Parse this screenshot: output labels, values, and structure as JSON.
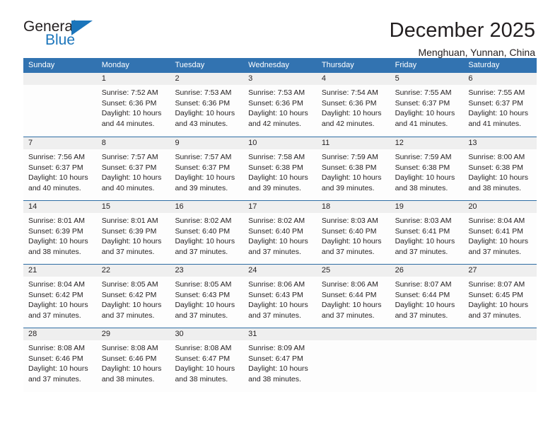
{
  "brand": {
    "name_top": "General",
    "name_bottom": "Blue",
    "accent_color": "#1b75bb"
  },
  "header": {
    "title": "December 2025",
    "subtitle": "Menghuan, Yunnan, China"
  },
  "calendar": {
    "header_bg": "#3273b1",
    "row_divider_color": "#2e6da4",
    "daynum_bg": "#efefef",
    "weekdays": [
      "Sunday",
      "Monday",
      "Tuesday",
      "Wednesday",
      "Thursday",
      "Friday",
      "Saturday"
    ],
    "weeks": [
      {
        "days": [
          {
            "num": "",
            "lines": []
          },
          {
            "num": "1",
            "lines": [
              "Sunrise: 7:52 AM",
              "Sunset: 6:36 PM",
              "Daylight: 10 hours",
              "and 44 minutes."
            ]
          },
          {
            "num": "2",
            "lines": [
              "Sunrise: 7:53 AM",
              "Sunset: 6:36 PM",
              "Daylight: 10 hours",
              "and 43 minutes."
            ]
          },
          {
            "num": "3",
            "lines": [
              "Sunrise: 7:53 AM",
              "Sunset: 6:36 PM",
              "Daylight: 10 hours",
              "and 42 minutes."
            ]
          },
          {
            "num": "4",
            "lines": [
              "Sunrise: 7:54 AM",
              "Sunset: 6:36 PM",
              "Daylight: 10 hours",
              "and 42 minutes."
            ]
          },
          {
            "num": "5",
            "lines": [
              "Sunrise: 7:55 AM",
              "Sunset: 6:37 PM",
              "Daylight: 10 hours",
              "and 41 minutes."
            ]
          },
          {
            "num": "6",
            "lines": [
              "Sunrise: 7:55 AM",
              "Sunset: 6:37 PM",
              "Daylight: 10 hours",
              "and 41 minutes."
            ]
          }
        ]
      },
      {
        "days": [
          {
            "num": "7",
            "lines": [
              "Sunrise: 7:56 AM",
              "Sunset: 6:37 PM",
              "Daylight: 10 hours",
              "and 40 minutes."
            ]
          },
          {
            "num": "8",
            "lines": [
              "Sunrise: 7:57 AM",
              "Sunset: 6:37 PM",
              "Daylight: 10 hours",
              "and 40 minutes."
            ]
          },
          {
            "num": "9",
            "lines": [
              "Sunrise: 7:57 AM",
              "Sunset: 6:37 PM",
              "Daylight: 10 hours",
              "and 39 minutes."
            ]
          },
          {
            "num": "10",
            "lines": [
              "Sunrise: 7:58 AM",
              "Sunset: 6:38 PM",
              "Daylight: 10 hours",
              "and 39 minutes."
            ]
          },
          {
            "num": "11",
            "lines": [
              "Sunrise: 7:59 AM",
              "Sunset: 6:38 PM",
              "Daylight: 10 hours",
              "and 39 minutes."
            ]
          },
          {
            "num": "12",
            "lines": [
              "Sunrise: 7:59 AM",
              "Sunset: 6:38 PM",
              "Daylight: 10 hours",
              "and 38 minutes."
            ]
          },
          {
            "num": "13",
            "lines": [
              "Sunrise: 8:00 AM",
              "Sunset: 6:38 PM",
              "Daylight: 10 hours",
              "and 38 minutes."
            ]
          }
        ]
      },
      {
        "days": [
          {
            "num": "14",
            "lines": [
              "Sunrise: 8:01 AM",
              "Sunset: 6:39 PM",
              "Daylight: 10 hours",
              "and 38 minutes."
            ]
          },
          {
            "num": "15",
            "lines": [
              "Sunrise: 8:01 AM",
              "Sunset: 6:39 PM",
              "Daylight: 10 hours",
              "and 37 minutes."
            ]
          },
          {
            "num": "16",
            "lines": [
              "Sunrise: 8:02 AM",
              "Sunset: 6:40 PM",
              "Daylight: 10 hours",
              "and 37 minutes."
            ]
          },
          {
            "num": "17",
            "lines": [
              "Sunrise: 8:02 AM",
              "Sunset: 6:40 PM",
              "Daylight: 10 hours",
              "and 37 minutes."
            ]
          },
          {
            "num": "18",
            "lines": [
              "Sunrise: 8:03 AM",
              "Sunset: 6:40 PM",
              "Daylight: 10 hours",
              "and 37 minutes."
            ]
          },
          {
            "num": "19",
            "lines": [
              "Sunrise: 8:03 AM",
              "Sunset: 6:41 PM",
              "Daylight: 10 hours",
              "and 37 minutes."
            ]
          },
          {
            "num": "20",
            "lines": [
              "Sunrise: 8:04 AM",
              "Sunset: 6:41 PM",
              "Daylight: 10 hours",
              "and 37 minutes."
            ]
          }
        ]
      },
      {
        "days": [
          {
            "num": "21",
            "lines": [
              "Sunrise: 8:04 AM",
              "Sunset: 6:42 PM",
              "Daylight: 10 hours",
              "and 37 minutes."
            ]
          },
          {
            "num": "22",
            "lines": [
              "Sunrise: 8:05 AM",
              "Sunset: 6:42 PM",
              "Daylight: 10 hours",
              "and 37 minutes."
            ]
          },
          {
            "num": "23",
            "lines": [
              "Sunrise: 8:05 AM",
              "Sunset: 6:43 PM",
              "Daylight: 10 hours",
              "and 37 minutes."
            ]
          },
          {
            "num": "24",
            "lines": [
              "Sunrise: 8:06 AM",
              "Sunset: 6:43 PM",
              "Daylight: 10 hours",
              "and 37 minutes."
            ]
          },
          {
            "num": "25",
            "lines": [
              "Sunrise: 8:06 AM",
              "Sunset: 6:44 PM",
              "Daylight: 10 hours",
              "and 37 minutes."
            ]
          },
          {
            "num": "26",
            "lines": [
              "Sunrise: 8:07 AM",
              "Sunset: 6:44 PM",
              "Daylight: 10 hours",
              "and 37 minutes."
            ]
          },
          {
            "num": "27",
            "lines": [
              "Sunrise: 8:07 AM",
              "Sunset: 6:45 PM",
              "Daylight: 10 hours",
              "and 37 minutes."
            ]
          }
        ]
      },
      {
        "days": [
          {
            "num": "28",
            "lines": [
              "Sunrise: 8:08 AM",
              "Sunset: 6:46 PM",
              "Daylight: 10 hours",
              "and 37 minutes."
            ]
          },
          {
            "num": "29",
            "lines": [
              "Sunrise: 8:08 AM",
              "Sunset: 6:46 PM",
              "Daylight: 10 hours",
              "and 38 minutes."
            ]
          },
          {
            "num": "30",
            "lines": [
              "Sunrise: 8:08 AM",
              "Sunset: 6:47 PM",
              "Daylight: 10 hours",
              "and 38 minutes."
            ]
          },
          {
            "num": "31",
            "lines": [
              "Sunrise: 8:09 AM",
              "Sunset: 6:47 PM",
              "Daylight: 10 hours",
              "and 38 minutes."
            ]
          },
          {
            "num": "",
            "lines": []
          },
          {
            "num": "",
            "lines": []
          },
          {
            "num": "",
            "lines": []
          }
        ]
      }
    ]
  }
}
